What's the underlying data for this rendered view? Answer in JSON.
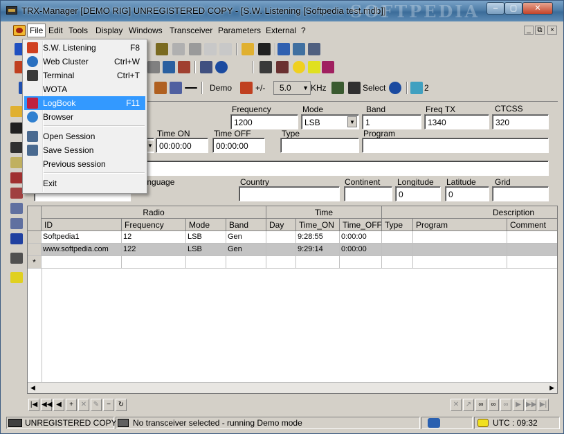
{
  "window": {
    "title": "TRX-Manager [DEMO RIG] UNREGISTERED COPY - [S.W. Listening [Softpedia test.mdb]]",
    "watermark": "SOFTPEDIA",
    "min_label": "–",
    "max_label": "▢",
    "close_label": "✕"
  },
  "menubar": {
    "items": [
      {
        "label": "File",
        "accel": "F"
      },
      {
        "label": "Edit"
      },
      {
        "label": "Tools"
      },
      {
        "label": "Display"
      },
      {
        "label": "Windows"
      },
      {
        "label": "Transceiver"
      },
      {
        "label": "Parameters"
      },
      {
        "label": "External"
      },
      {
        "label": "?"
      }
    ],
    "mdi": {
      "min": "_",
      "restore": "⧉",
      "close": "×"
    }
  },
  "file_menu": {
    "items": [
      {
        "label": "S.W. Listening",
        "shortcut": "F8",
        "icon": "sw-listening-icon"
      },
      {
        "label": "Web Cluster",
        "shortcut": "Ctrl+W",
        "icon": "globe-icon"
      },
      {
        "label": "Terminal",
        "shortcut": "Ctrl+T",
        "icon": "terminal-icon"
      },
      {
        "label": "WOTA",
        "shortcut": "",
        "icon": ""
      },
      {
        "label": "LogBook",
        "shortcut": "F11",
        "icon": "logbook-icon"
      },
      {
        "label": "Browser",
        "shortcut": "",
        "icon": "ie-browser-icon"
      },
      {
        "label": "Open Session",
        "shortcut": "",
        "icon": "open-session-icon"
      },
      {
        "label": "Save Session",
        "shortcut": "",
        "icon": "save-session-icon"
      },
      {
        "label": "Previous session",
        "shortcut": "",
        "icon": ""
      },
      {
        "label": "Exit",
        "shortcut": "",
        "icon": ""
      }
    ],
    "highlighted_index": 4
  },
  "toolbar3": {
    "demo_label": "Demo",
    "plusminus_label": "+/-",
    "speed_value": "5.0",
    "unit_label": "KHz",
    "select_label": "Select",
    "count_label": "2"
  },
  "form": {
    "frequency": {
      "label": "Frequency",
      "value": "1200"
    },
    "mode": {
      "label": "Mode",
      "value": "LSB"
    },
    "band": {
      "label": "Band",
      "value": "1"
    },
    "freq_tx": {
      "label": "Freq TX",
      "value": "1340"
    },
    "ctcss": {
      "label": "CTCSS",
      "value": "320"
    },
    "time_on": {
      "label": "Time ON",
      "value": "00:00:00"
    },
    "time_off": {
      "label": "Time OFF",
      "value": "00:00:00"
    },
    "type": {
      "label": "Type",
      "value": ""
    },
    "program": {
      "label": "Program",
      "value": ""
    },
    "language": {
      "label": "Language",
      "value": ""
    },
    "country": {
      "label": "Country",
      "value": ""
    },
    "continent": {
      "label": "Continent",
      "value": ""
    },
    "longitude": {
      "label": "Longitude",
      "value": "0"
    },
    "latitude": {
      "label": "Latitude",
      "value": "0"
    },
    "grid": {
      "label": "Grid",
      "value": ""
    }
  },
  "table": {
    "groups": [
      "Radio",
      "Time",
      "Description"
    ],
    "columns": [
      "ID",
      "Frequency",
      "Mode",
      "Band",
      "Day",
      "Time_ON",
      "Time_OFF",
      "Type",
      "Program",
      "Comment"
    ],
    "rows": [
      [
        "Softpedia1",
        "12",
        "LSB",
        "Gen",
        "",
        "9:28:55",
        "0:00:00",
        "",
        "",
        ""
      ],
      [
        "www.softpedia.com",
        "122",
        "LSB",
        "Gen",
        "",
        "9:29:14",
        "0:00:00",
        "",
        "",
        ""
      ]
    ],
    "new_row_marker": "*"
  },
  "status": {
    "registration": "UNREGISTERED COPY",
    "message": "No transceiver selected - running Demo mode",
    "utc": "UTC : 09:32"
  }
}
